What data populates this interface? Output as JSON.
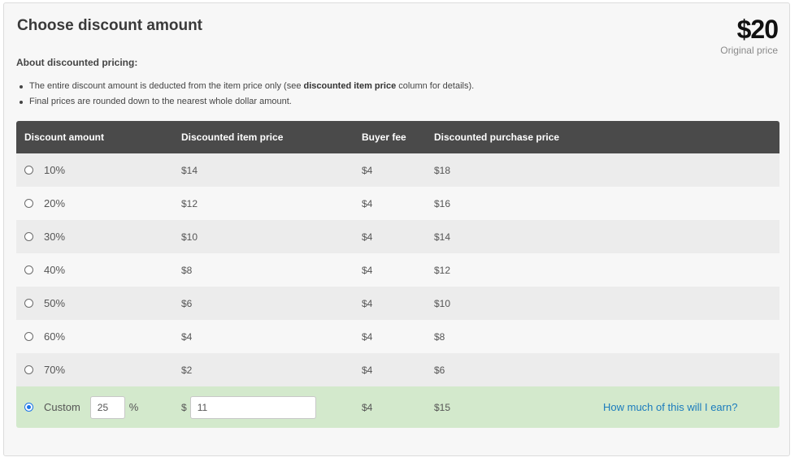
{
  "header": {
    "title": "Choose discount amount",
    "price": "$20",
    "price_label": "Original price"
  },
  "about": {
    "heading": "About discounted pricing:",
    "note1_before": "The entire discount amount is deducted from the item price only (see ",
    "note1_bold": "discounted item price",
    "note1_after": " column for details).",
    "note2": "Final prices are rounded down to the nearest whole dollar amount."
  },
  "table": {
    "headers": [
      "Discount amount",
      "Discounted item price",
      "Buyer fee",
      "Discounted purchase price"
    ],
    "rows": [
      {
        "discount": "10%",
        "item_price": "$14",
        "fee": "$4",
        "purchase": "$18"
      },
      {
        "discount": "20%",
        "item_price": "$12",
        "fee": "$4",
        "purchase": "$16"
      },
      {
        "discount": "30%",
        "item_price": "$10",
        "fee": "$4",
        "purchase": "$14"
      },
      {
        "discount": "40%",
        "item_price": "$8",
        "fee": "$4",
        "purchase": "$12"
      },
      {
        "discount": "50%",
        "item_price": "$6",
        "fee": "$4",
        "purchase": "$10"
      },
      {
        "discount": "60%",
        "item_price": "$4",
        "fee": "$4",
        "purchase": "$8"
      },
      {
        "discount": "70%",
        "item_price": "$2",
        "fee": "$4",
        "purchase": "$6"
      }
    ],
    "selected_option": "custom",
    "custom": {
      "label": "Custom",
      "percent_value": "25",
      "percent_sign": "%",
      "currency_sign": "$",
      "price_value": "11",
      "fee": "$4",
      "purchase": "$15",
      "earn_link": "How much of this will I earn?"
    }
  },
  "colors": {
    "header_bg": "#4a4a4a",
    "custom_row_bg": "#d3e9cc",
    "link": "#1a7bbd",
    "radio_selected": "#1a73e8"
  }
}
